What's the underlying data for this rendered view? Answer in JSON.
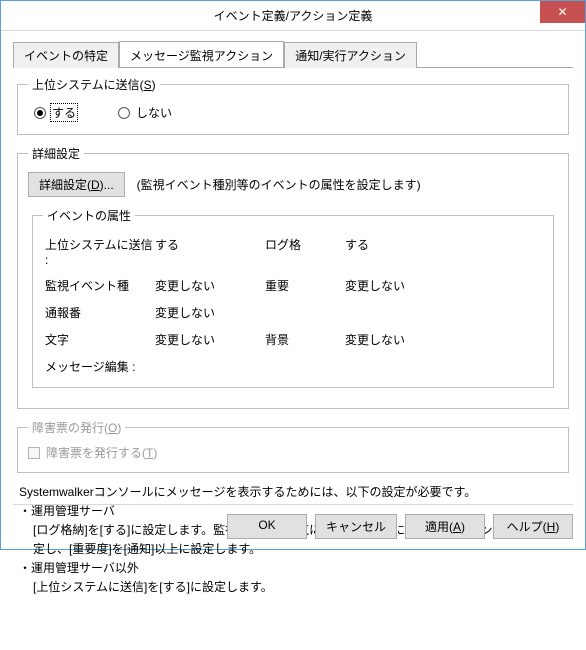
{
  "titlebar": {
    "title": "イベント定義/アクション定義",
    "close": "✕"
  },
  "tabs": [
    {
      "label": "イベントの特定"
    },
    {
      "label": "メッセージ監視アクション"
    },
    {
      "label": "通知/実行アクション"
    }
  ],
  "send_group": {
    "legend": "上位システムに送信(",
    "legend_u": "S",
    "legend_end": ")",
    "opt_yes": "する",
    "opt_no": "しない"
  },
  "detail_group": {
    "legend": "詳細設定",
    "button": "詳細設定(",
    "button_u": "D",
    "button_end": ")...",
    "hint": "(監視イベント種別等のイベントの属性を設定します)"
  },
  "attrs": {
    "legend": "イベントの属性",
    "r1l": "上位システムに送信 :",
    "r1v": "する",
    "r1l2": "ログ格",
    "r1v2": "する",
    "r2l": "監視イベント種",
    "r2v": "変更しない",
    "r2l2": "重要",
    "r2v2": "変更しない",
    "r3l": "通報番",
    "r3v": "変更しない",
    "r4l": "文字",
    "r4v": "変更しない",
    "r4l2": "背景",
    "r4v2": "変更しない",
    "r5l": "メッセージ編集 :"
  },
  "trouble_group": {
    "legend": "障害票の発行(",
    "legend_u": "O",
    "legend_end": ")",
    "chk": "障害票を発行する(",
    "chk_u": "T",
    "chk_end": ")"
  },
  "notes": {
    "l1": "Systemwalkerコンソールにメッセージを表示するためには、以下の設定が必要です。",
    "l2": "・運用管理サーバ",
    "l3": "[ログ格納]を[する]に設定します。監視イベント一覧に表示するためには、[監視イベント種別]を設定し、[重要度]を[通知]以上に設定します。",
    "l4": "・運用管理サーバ以外",
    "l5": "[上位システムに送信]を[する]に設定します。"
  },
  "buttons": {
    "ok": "OK",
    "cancel": "キャンセル",
    "apply": "適用(",
    "apply_u": "A",
    "apply_end": ")",
    "help": "ヘルプ(",
    "help_u": "H",
    "help_end": ")"
  }
}
